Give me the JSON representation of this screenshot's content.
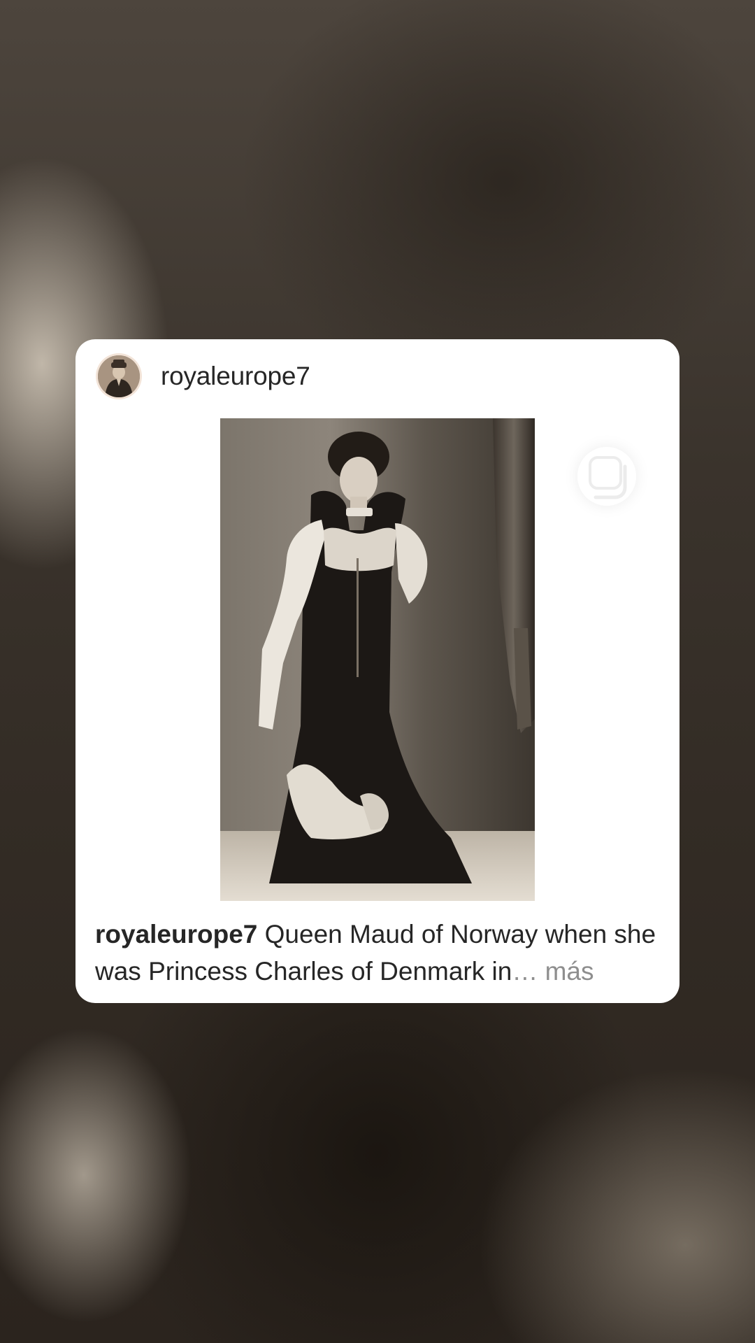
{
  "post": {
    "username": "royaleurope7",
    "caption_username": "royaleurope7",
    "caption_text": " Queen Maud of Norway when she was Princess Charles of Denmark in",
    "caption_ellipsis": "…",
    "more_label": " más"
  },
  "icons": {
    "multi": "carousel-multi-icon",
    "avatar": "profile-avatar"
  },
  "colors": {
    "card_bg": "#ffffff",
    "text": "#262626",
    "muted": "#8e8e8e"
  }
}
